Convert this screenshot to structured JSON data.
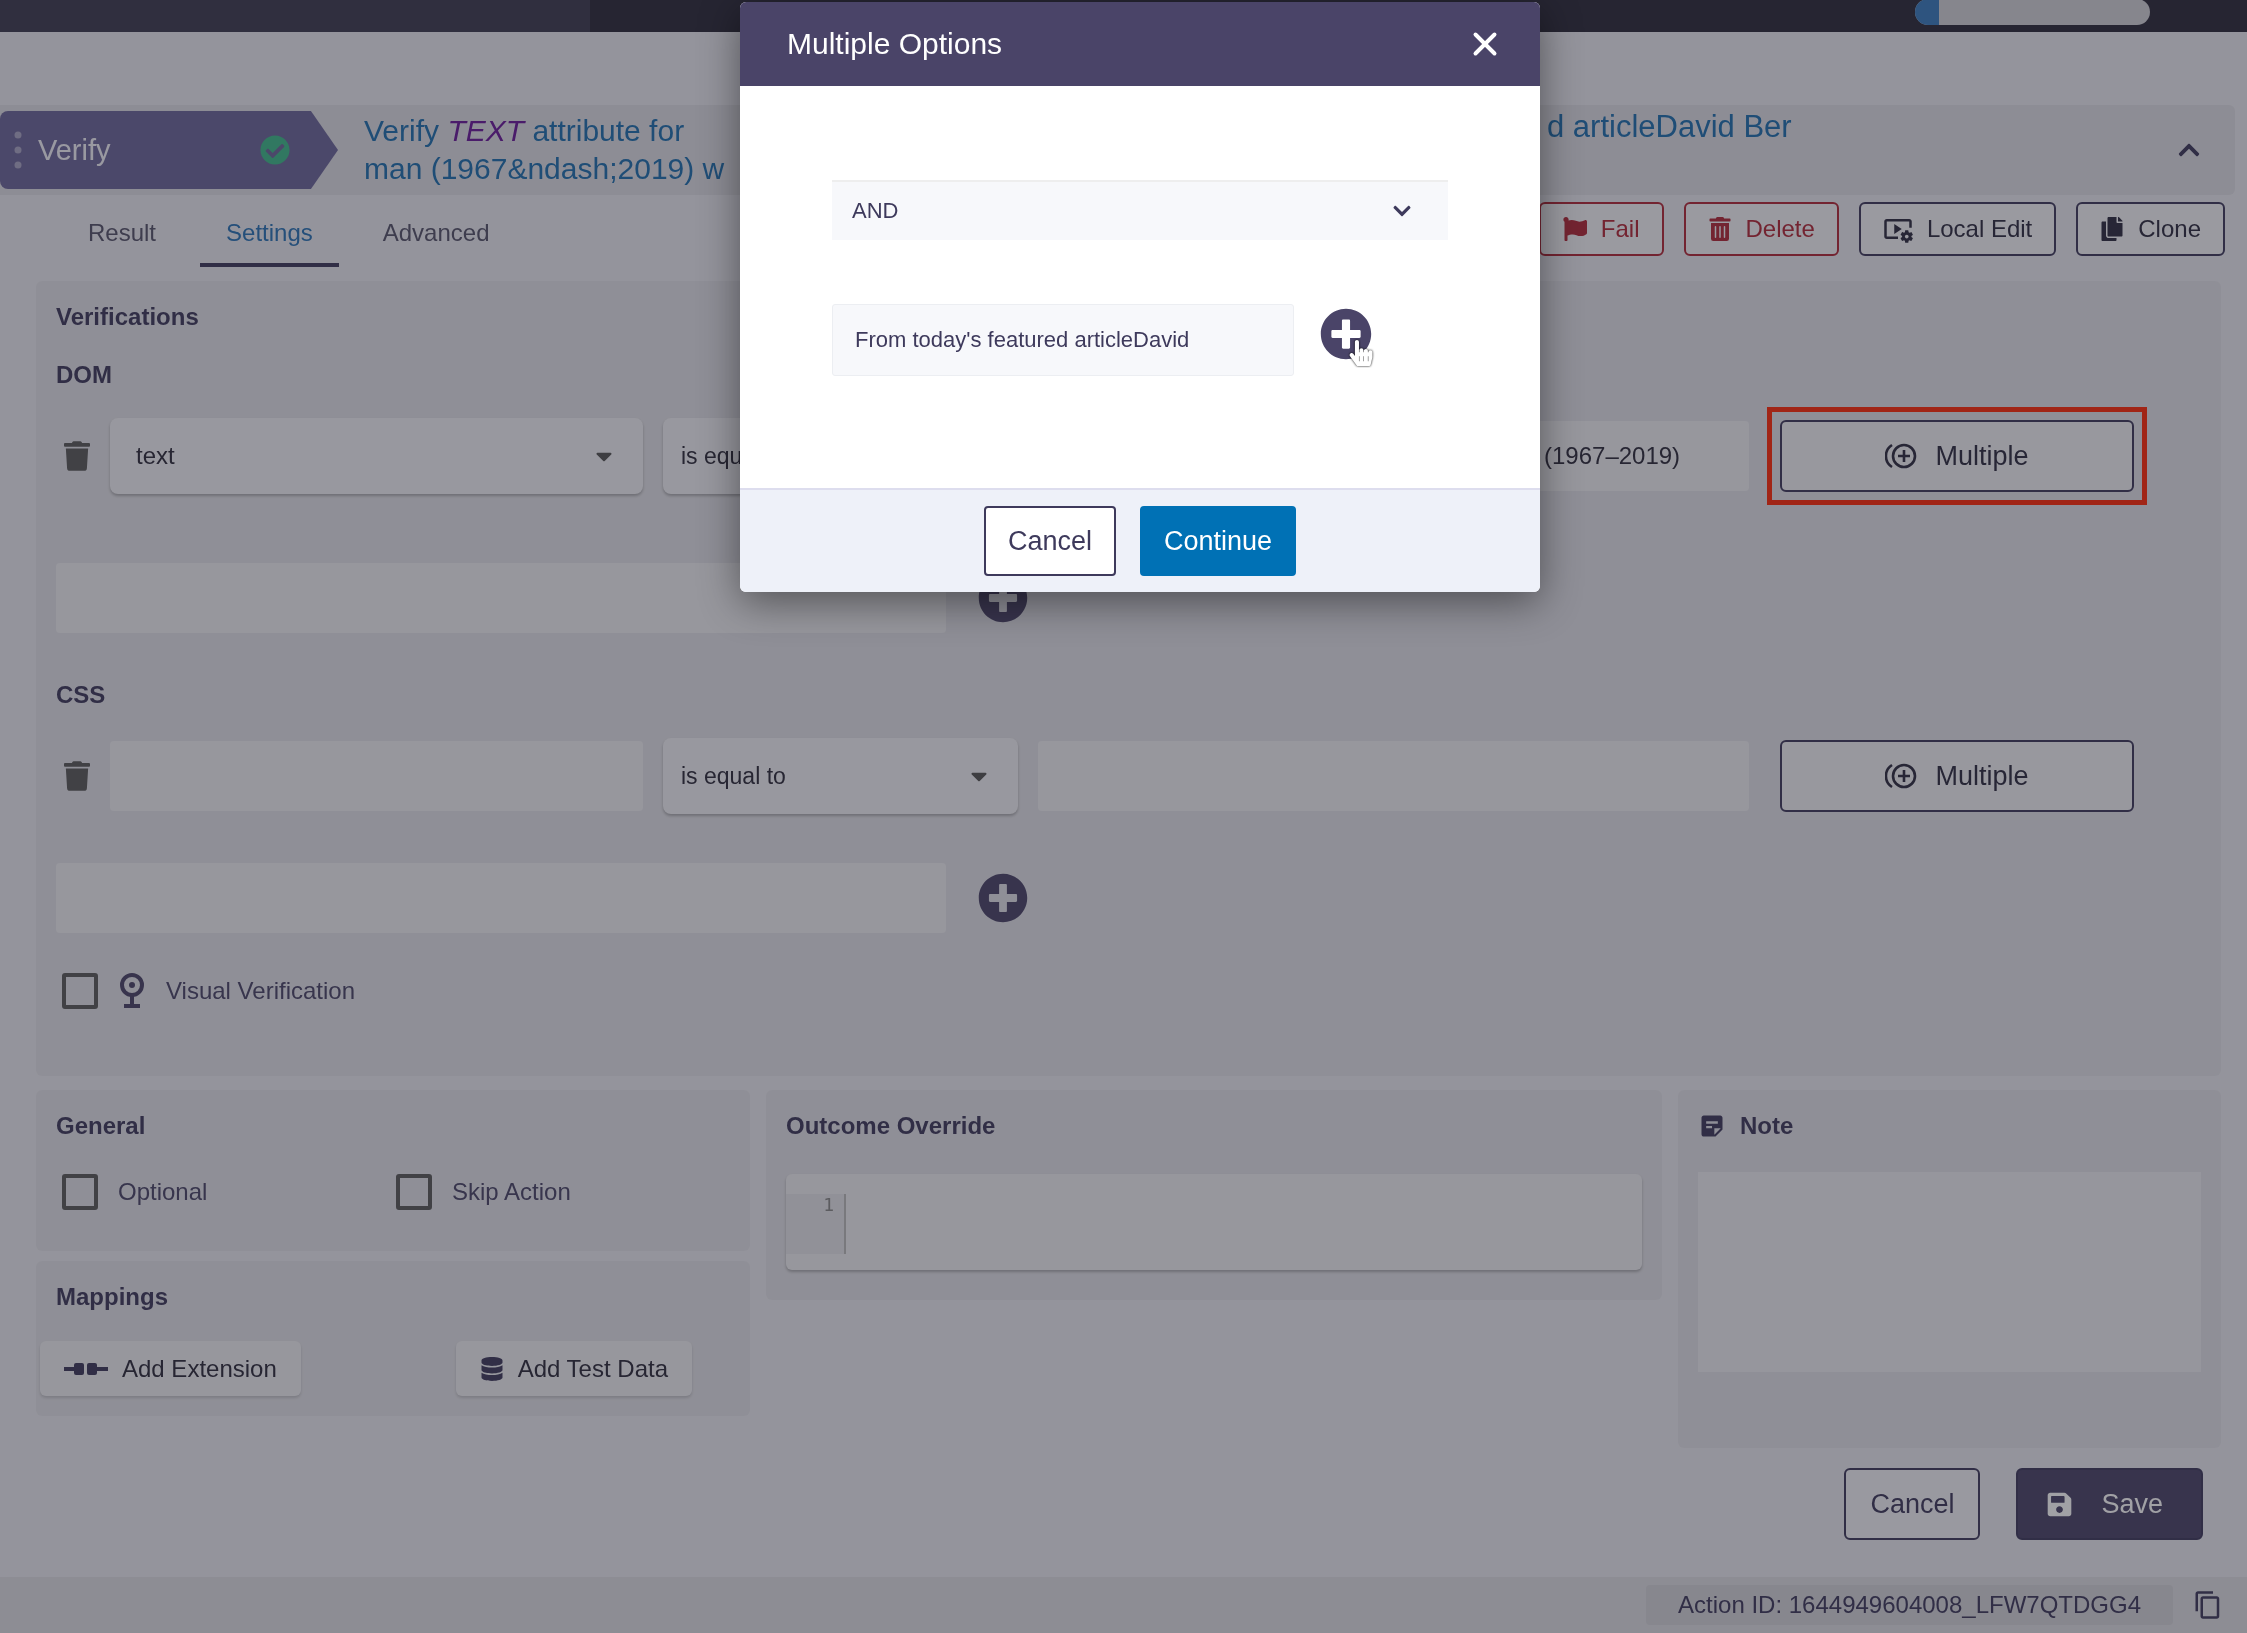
{
  "top_bar": {
    "progress": {
      "level": 0.1
    }
  },
  "step": {
    "type_label": "Verify",
    "passed": true,
    "title_start": "Verify *TEXT* attribute for",
    "title_line2": "man (1967&ndash;2019) w",
    "title_end": "d articleDavid Ber",
    "expanded": true
  },
  "tabs": [
    {
      "label": "Result",
      "selected": false
    },
    {
      "label": "Settings",
      "selected": true
    },
    {
      "label": "Advanced",
      "selected": false
    }
  ],
  "actions": [
    {
      "label": "Fail",
      "kind": "fail"
    },
    {
      "label": "Delete",
      "kind": "delete"
    },
    {
      "label": "Local Edit",
      "kind": "local-edit"
    },
    {
      "label": "Clone",
      "kind": "clone"
    }
  ],
  "verifications": {
    "title": "Verifications",
    "sections": [
      {
        "label": "DOM",
        "attribute": "text",
        "operator": "is equ",
        "value": "(1967–2019)",
        "multiple_label": "Multiple",
        "highlighted": true
      },
      {
        "label": "CSS",
        "operator": "is equal to",
        "multiple_label": "Multiple",
        "highlighted": false
      }
    ],
    "visual": {
      "label": "Visual Verification",
      "checked": false
    }
  },
  "general": {
    "title": "General",
    "options": [
      {
        "label": "Optional",
        "checked": false
      },
      {
        "label": "Skip Action",
        "checked": false
      }
    ]
  },
  "mappings": {
    "title": "Mappings",
    "buttons": [
      {
        "label": "Add Extension",
        "kind": "extension"
      },
      {
        "label": "Add Test Data",
        "kind": "test-data"
      }
    ]
  },
  "outcome_override": {
    "title": "Outcome Override",
    "line_numbers": [
      "1"
    ]
  },
  "note": {
    "title": "Note"
  },
  "footer": {
    "buttons": [
      {
        "label": "Cancel",
        "kind": "secondary"
      },
      {
        "label": "Save",
        "kind": "primary"
      }
    ]
  },
  "status_bar": {
    "action_id": "Action ID: 1644949604008_LFW7QTDGG4"
  },
  "modal": {
    "title": "Multiple Options",
    "operator": "AND",
    "values": [
      "From today's featured articleDavid"
    ],
    "buttons": [
      {
        "label": "Cancel",
        "kind": "secondary"
      },
      {
        "label": "Continue",
        "kind": "primary"
      }
    ]
  }
}
